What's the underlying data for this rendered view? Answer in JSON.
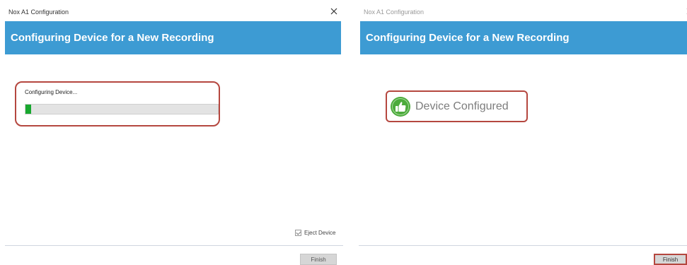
{
  "left_window": {
    "title": "Nox A1 Configuration",
    "close_glyph": "✕",
    "banner": "Configuring Device for a New Recording",
    "progress_label": "Configuring Device...",
    "progress_fraction": 0.03,
    "eject_label": "Eject Device",
    "eject_checked": true,
    "finish_label": "Finish"
  },
  "right_window": {
    "title": "Nox A1 Configuration",
    "close_glyph": "✕",
    "banner": "Configuring Device for a New Recording",
    "status_text": "Device Configured",
    "status_icon": "thumbs-up-icon",
    "finish_label": "Finish"
  },
  "colors": {
    "banner": "#3d9bd3",
    "highlight_border": "#b5473f",
    "progress_fill": "#18a82f",
    "success_icon": "#4cab3c"
  }
}
